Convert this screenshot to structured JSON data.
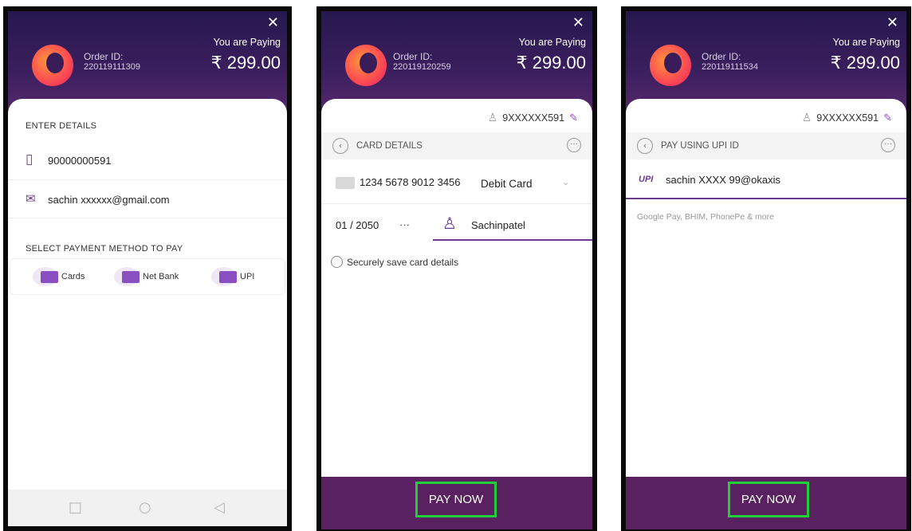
{
  "common": {
    "close": "✕",
    "order_label": "Order ID:",
    "paying_label": "You are Paying",
    "amount": "₹ 299.00"
  },
  "screen1": {
    "order_id": "220119111309",
    "enter_details": "ENTER DETAILS",
    "phone": "90000000591",
    "email": "sachin xxxxxx@gmail.com",
    "select_method": "SELECT PAYMENT METHOD TO PAY",
    "methods": [
      {
        "label": "Cards",
        "icon": "card-icon"
      },
      {
        "label": "Net Bank",
        "icon": "bank-icon"
      },
      {
        "label": "UPI",
        "icon": "upi-icon"
      }
    ],
    "nav": {
      "square": "□",
      "circle": "○",
      "back": "◁"
    }
  },
  "screen2": {
    "order_id": "220119120259",
    "user": "9XXXXXX591",
    "section": "CARD DETAILS",
    "card_number": "1234 5678 9012 3456",
    "card_type": "Debit Card",
    "expiry": "01 / 2050",
    "cvv": "···",
    "holder": "Sachinpatel",
    "save_card": "Securely save card details",
    "pay_now": "PAY NOW"
  },
  "screen3": {
    "order_id": "220119111534",
    "user": "9XXXXXX591",
    "section": "PAY USING UPI ID",
    "upi_logo": "UPI",
    "upi_id": "sachin XXXX 99@okaxis",
    "upi_apps": "Google Pay, BHIM, PhonePe & more",
    "pay_now": "PAY NOW"
  },
  "colors": {
    "header": "#3b1f5e",
    "accent": "#6b3b8f",
    "pay_bar": "#5a2160",
    "highlight": "#1fcf3a"
  }
}
